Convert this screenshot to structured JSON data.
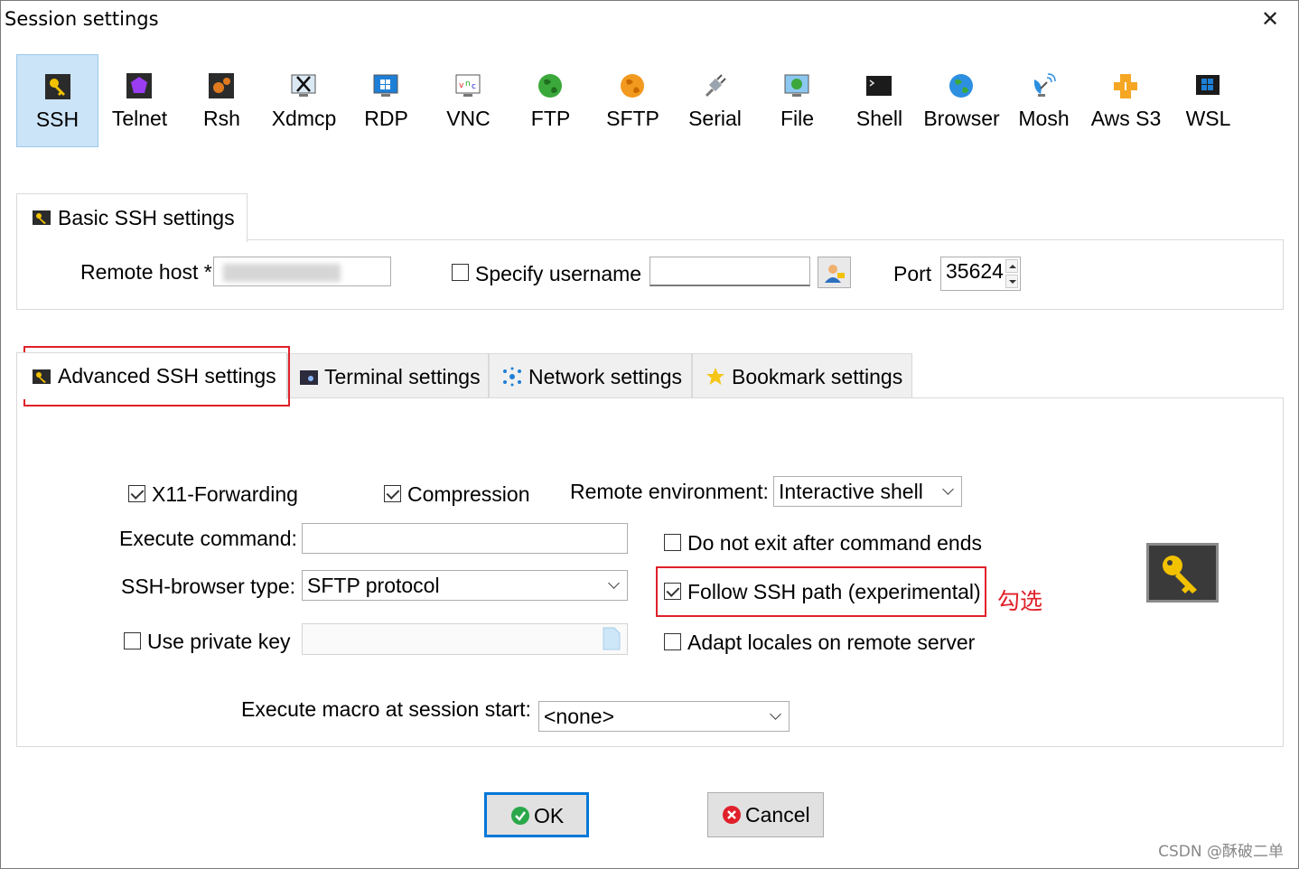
{
  "window": {
    "title": "Session settings",
    "close_glyph": "✕"
  },
  "session_types": [
    {
      "label": "SSH",
      "icon": "ssh-key-icon",
      "active": true
    },
    {
      "label": "Telnet",
      "icon": "telnet-icon"
    },
    {
      "label": "Rsh",
      "icon": "rsh-icon"
    },
    {
      "label": "Xdmcp",
      "icon": "xdmcp-icon"
    },
    {
      "label": "RDP",
      "icon": "rdp-icon"
    },
    {
      "label": "VNC",
      "icon": "vnc-icon"
    },
    {
      "label": "FTP",
      "icon": "ftp-globe-icon"
    },
    {
      "label": "SFTP",
      "icon": "sftp-globe-icon"
    },
    {
      "label": "Serial",
      "icon": "serial-plug-icon"
    },
    {
      "label": "File",
      "icon": "file-monitor-icon"
    },
    {
      "label": "Shell",
      "icon": "shell-terminal-icon"
    },
    {
      "label": "Browser",
      "icon": "browser-globe-icon"
    },
    {
      "label": "Mosh",
      "icon": "mosh-satellite-icon"
    },
    {
      "label": "Aws S3",
      "icon": "aws-s3-boxes-icon"
    },
    {
      "label": "WSL",
      "icon": "wsl-windows-icon"
    }
  ],
  "basic": {
    "tab_label": "Basic SSH settings",
    "remote_host_label": "Remote host *",
    "remote_host_value": "",
    "specify_username_label": "Specify username",
    "specify_username_checked": false,
    "username_value": "",
    "port_label": "Port",
    "port_value": "35624"
  },
  "tabs": [
    {
      "label": "Advanced SSH settings",
      "active": true
    },
    {
      "label": "Terminal settings"
    },
    {
      "label": "Network settings"
    },
    {
      "label": "Bookmark settings"
    }
  ],
  "advanced": {
    "x11_label": "X11-Forwarding",
    "x11_checked": true,
    "compression_label": "Compression",
    "compression_checked": true,
    "remote_env_label": "Remote environment:",
    "remote_env_value": "Interactive shell",
    "execute_command_label": "Execute command:",
    "execute_command_value": "",
    "do_not_exit_label": "Do not exit after command ends",
    "do_not_exit_checked": false,
    "browser_type_label": "SSH-browser type:",
    "browser_type_value": "SFTP protocol",
    "follow_path_label": "Follow SSH path (experimental)",
    "follow_path_checked": true,
    "use_private_key_label": "Use private key",
    "use_private_key_checked": false,
    "private_key_value": "",
    "adapt_locales_label": "Adapt locales on remote server",
    "adapt_locales_checked": false,
    "macro_label": "Execute macro at session start:",
    "macro_value": "<none>"
  },
  "annotation": {
    "text": "勾选",
    "color": "#e0202a"
  },
  "buttons": {
    "ok_label": "OK",
    "cancel_label": "Cancel"
  },
  "watermark": "CSDN @酥破二单",
  "colors": {
    "active_tab_bg": "#cce4f7",
    "highlight_red": "#e0202a",
    "default_button_border": "#0078d7"
  }
}
